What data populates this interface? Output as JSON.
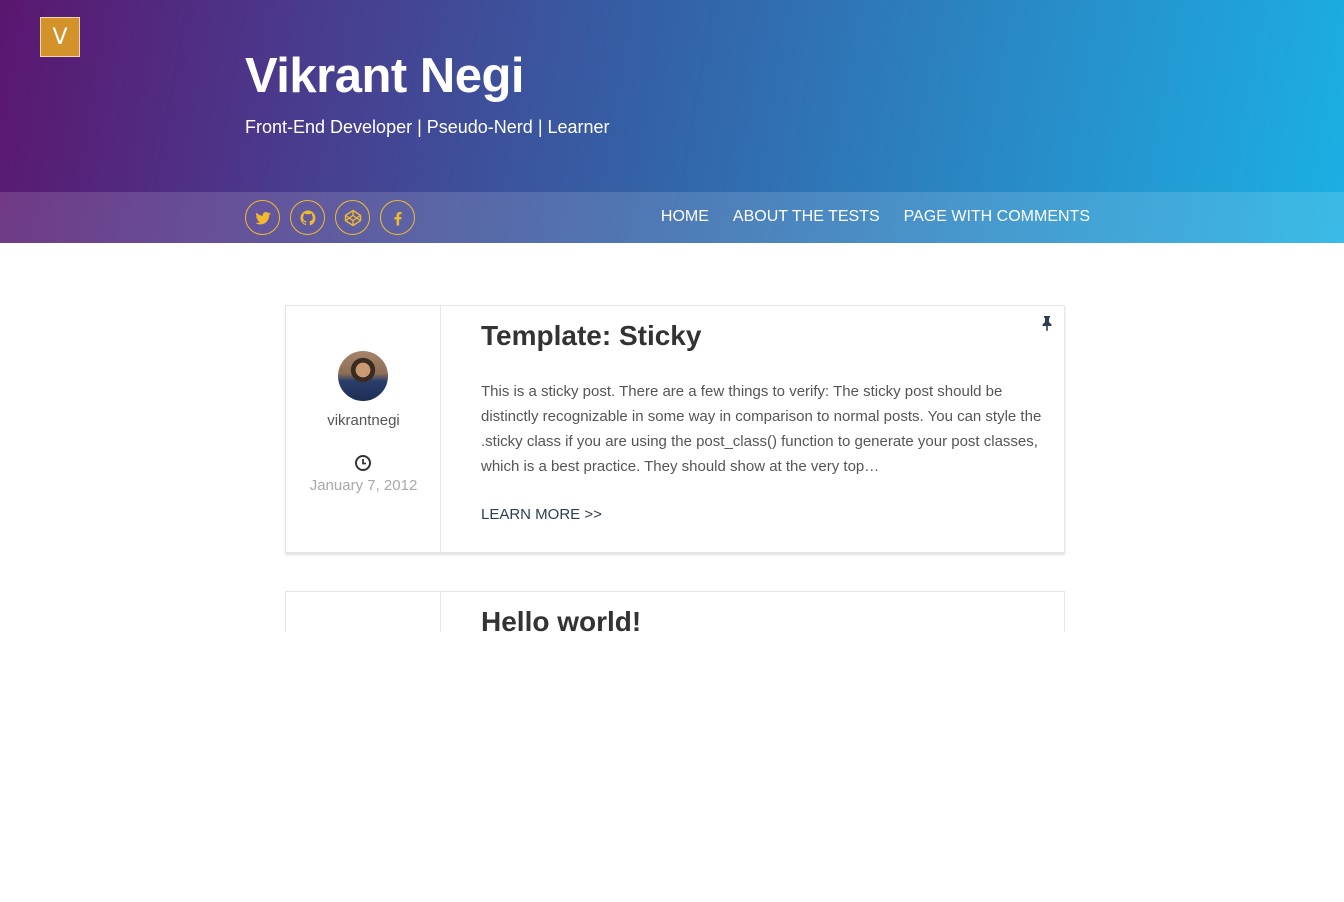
{
  "header": {
    "logo_letter": "V",
    "title": "Vikrant Negi",
    "tagline": "Front-End Developer | Pseudo-Nerd | Learner",
    "gradient": [
      "#5b1670",
      "#1bb0e3"
    ]
  },
  "social": [
    {
      "icon": "twitter-icon"
    },
    {
      "icon": "github-icon"
    },
    {
      "icon": "codepen-icon"
    },
    {
      "icon": "facebook-icon"
    }
  ],
  "accent_color": "#f2b92e",
  "nav": {
    "items": [
      "Home",
      "About The Tests",
      "Page with comments"
    ]
  },
  "posts": [
    {
      "title": "Template: Sticky",
      "author": "vikrantnegi",
      "date": "January 7, 2012",
      "excerpt": "This is a sticky post. There are a few things to verify: The sticky post should be distinctly recognizable in some way in comparison to normal posts. You can style the .sticky class if you are using the post_class() function to generate your post classes, which is a best practice. They should show at the very top…",
      "learn_more": "LEARN MORE >>",
      "sticky": true
    },
    {
      "title": "Hello world!"
    }
  ]
}
